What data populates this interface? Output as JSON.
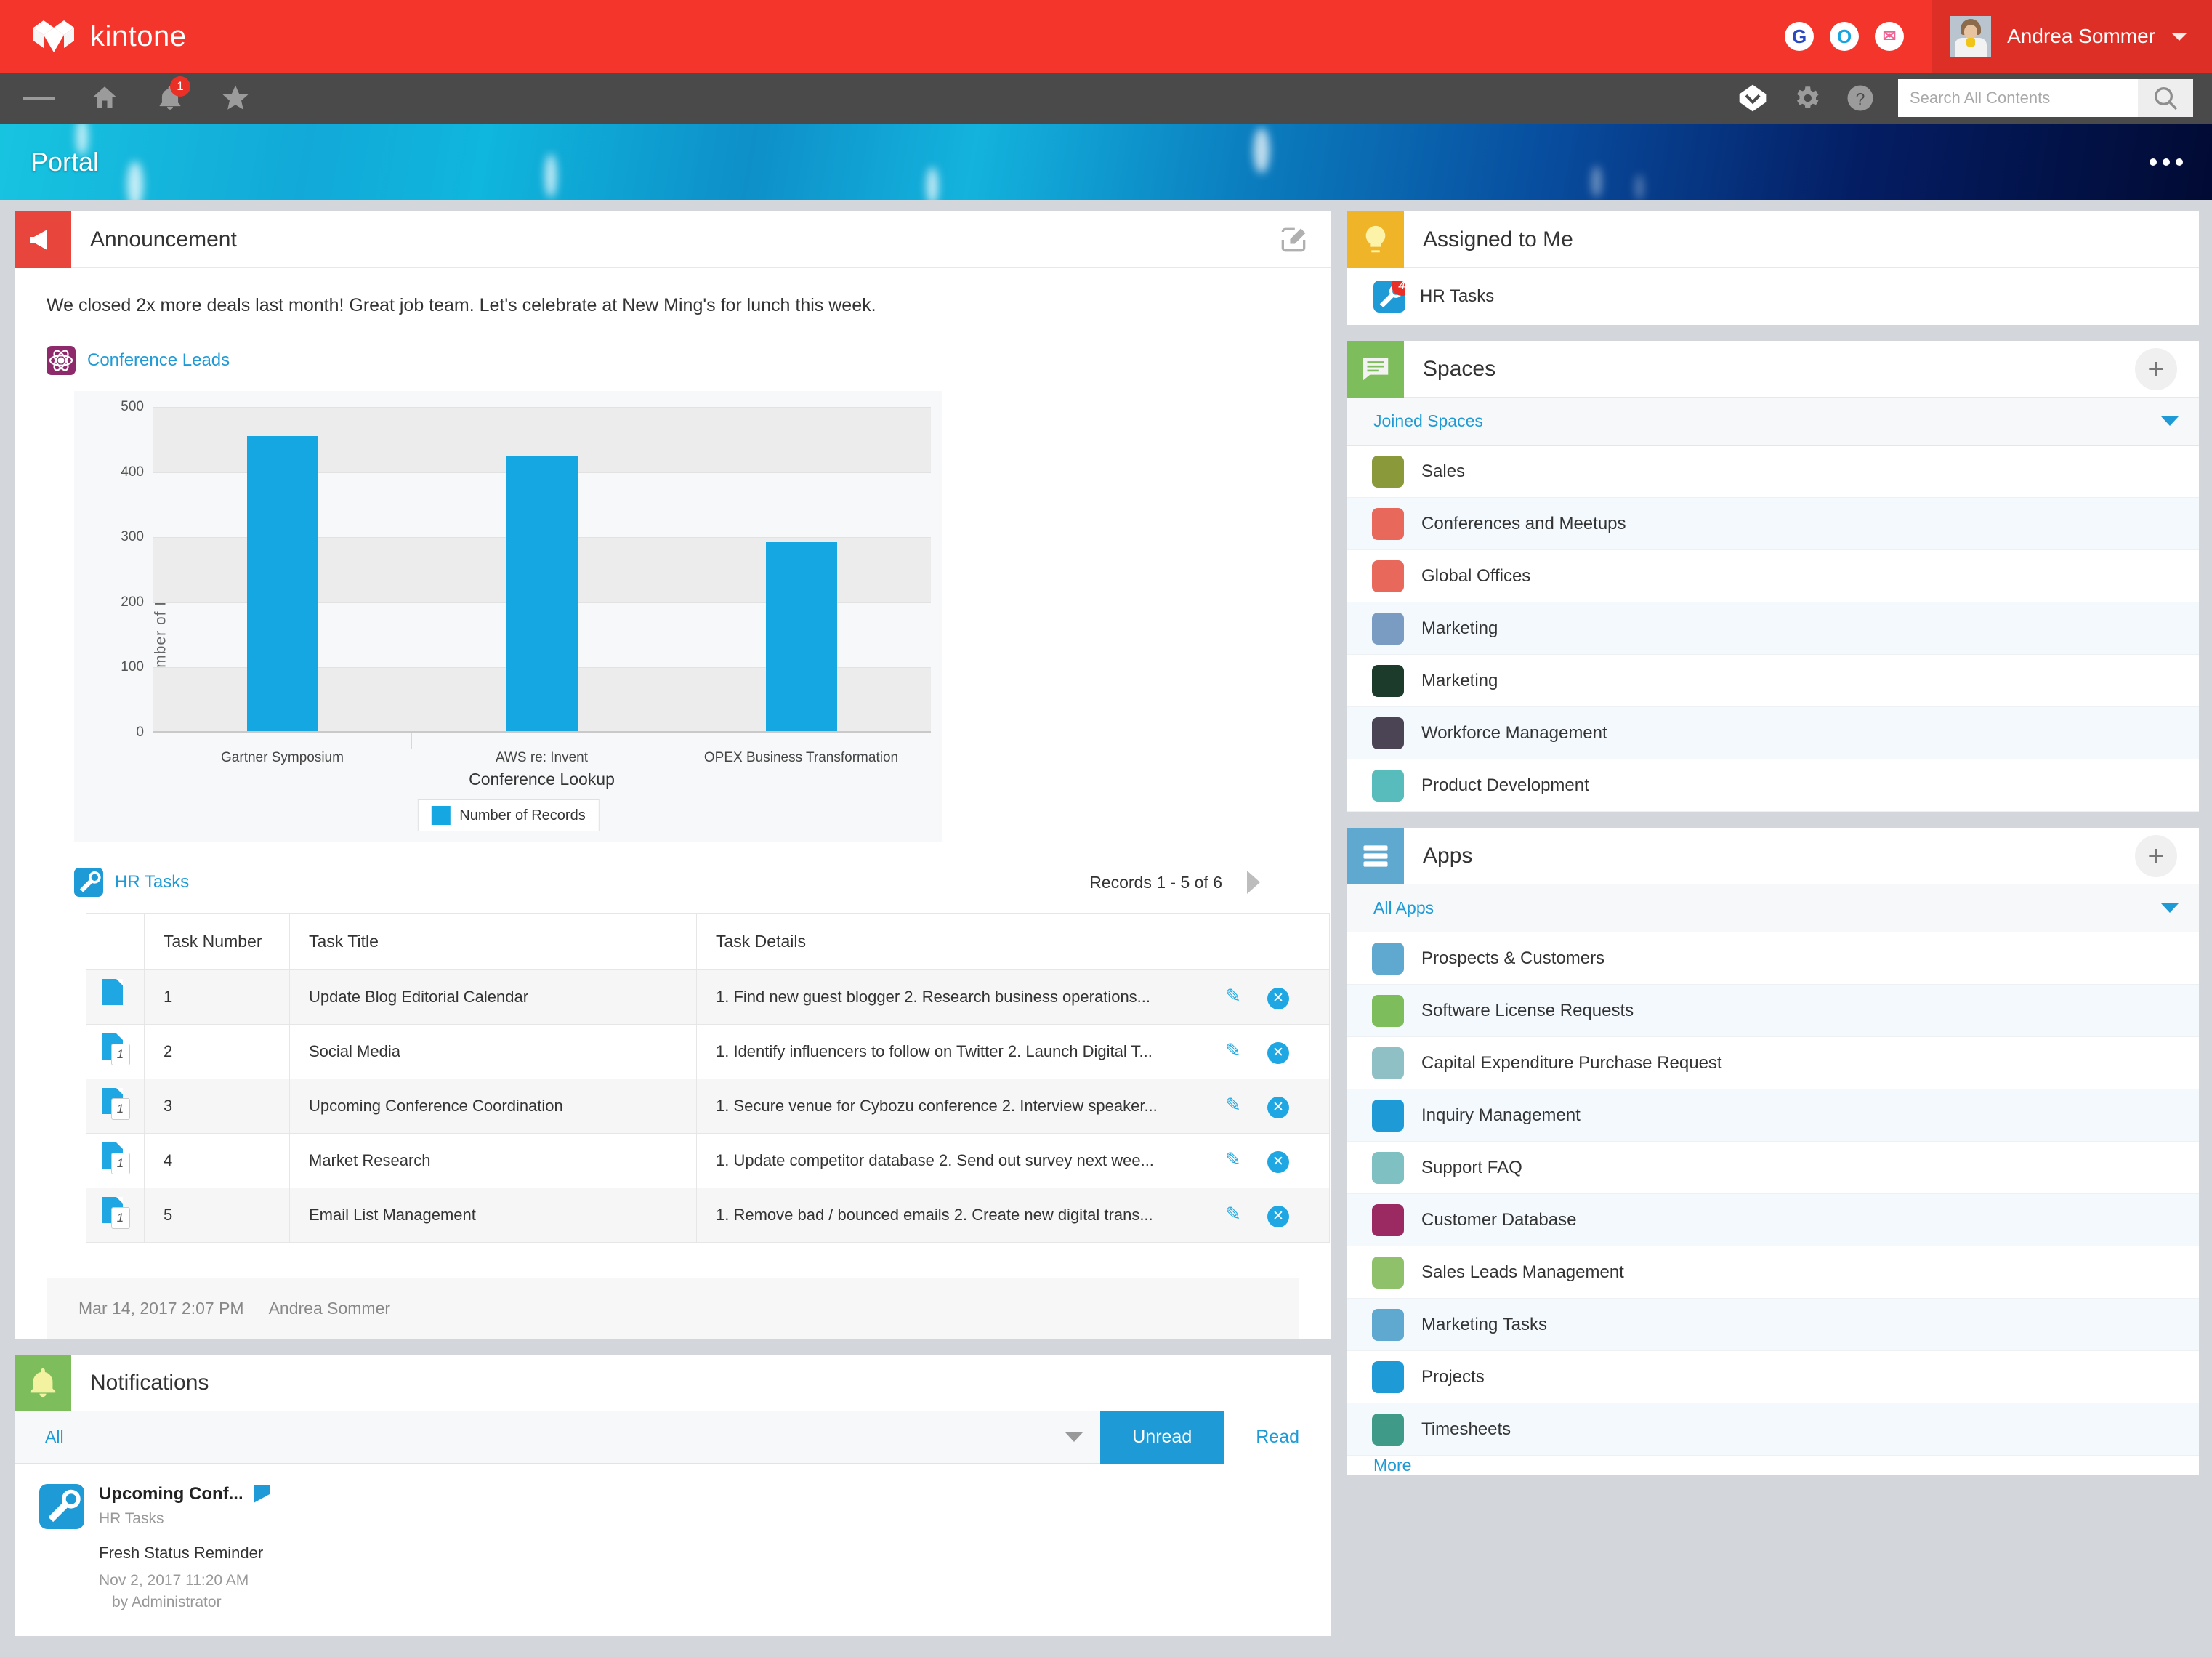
{
  "topbar": {
    "brand": "kintone",
    "icons": [
      {
        "name": "google-icon",
        "glyph": "G"
      },
      {
        "name": "office-icon",
        "glyph": "O"
      },
      {
        "name": "mail-icon",
        "glyph": "✉"
      }
    ],
    "user_name": "Andrea Sommer"
  },
  "navbar": {
    "notification_badge": "1",
    "search_placeholder": "Search All Contents",
    "search_value": ""
  },
  "banner": {
    "title": "Portal"
  },
  "announcement": {
    "title": "Announcement",
    "body": "We closed 2x more deals last month! Great job team. Let's celebrate at New Ming's for lunch this week.",
    "app_link": "Conference Leads",
    "footer_date": "Mar 14, 2017 2:07 PM",
    "footer_author": "Andrea Sommer"
  },
  "chart_data": {
    "type": "bar",
    "title": "",
    "categories": [
      "Gartner Symposium",
      "AWS re: Invent",
      "OPEX Business Transformation"
    ],
    "values": [
      455,
      425,
      292
    ],
    "series": [
      {
        "name": "Number of Records",
        "values": [
          455,
          425,
          292
        ]
      }
    ],
    "xlabel": "Conference Lookup",
    "ylabel": "Number of Records",
    "ylim": [
      0,
      500
    ],
    "yticks": [
      0,
      100,
      200,
      300,
      400,
      500
    ],
    "legend": [
      "Number of Records"
    ],
    "legend_position": "bottom",
    "grid": true,
    "bar_color": "#14a7e2"
  },
  "hr_tasks": {
    "app_name": "HR Tasks",
    "records_info": "Records 1 - 5  of 6",
    "columns": [
      "",
      "Task Number",
      "Task Title",
      "Task Details",
      ""
    ],
    "rows": [
      {
        "icon_count": "",
        "number": "1",
        "title": "Update Blog Editorial Calendar",
        "details": "1. Find new guest blogger  2. Research business operations..."
      },
      {
        "icon_count": "1",
        "number": "2",
        "title": "Social Media",
        "details": "1. Identify influencers to follow on Twitter 2. Launch Digital T..."
      },
      {
        "icon_count": "1",
        "number": "3",
        "title": "Upcoming Conference Coordination",
        "details": "1. Secure venue for Cybozu conference 2. Interview speaker..."
      },
      {
        "icon_count": "1",
        "number": "4",
        "title": "Market Research",
        "details": "1. Update competitor database 2. Send out survey next wee..."
      },
      {
        "icon_count": "1",
        "number": "5",
        "title": "Email List Management",
        "details": "1. Remove bad / bounced emails 2. Create new digital trans..."
      }
    ]
  },
  "notifications": {
    "title": "Notifications",
    "filter_label": "All",
    "tab_unread": "Unread",
    "tab_read": "Read",
    "items": [
      {
        "title": "Upcoming Conf...",
        "app": "HR Tasks",
        "subject": "Fresh Status Reminder",
        "timestamp": "Nov 2, 2017 11:20 AM",
        "author": "by Administrator"
      }
    ]
  },
  "assigned_to_me": {
    "title": "Assigned to Me",
    "items": [
      {
        "label": "HR Tasks",
        "badge": "4"
      }
    ]
  },
  "spaces": {
    "title": "Spaces",
    "group_label": "Joined Spaces",
    "items": [
      {
        "label": "Sales"
      },
      {
        "label": "Conferences and Meetups"
      },
      {
        "label": "Global Offices"
      },
      {
        "label": "Marketing"
      },
      {
        "label": "Marketing"
      },
      {
        "label": "Workforce Management"
      },
      {
        "label": "Product Development"
      }
    ]
  },
  "apps": {
    "title": "Apps",
    "group_label": "All Apps",
    "more_label": "More",
    "items": [
      {
        "label": "Prospects & Customers"
      },
      {
        "label": "Software License Requests"
      },
      {
        "label": "Capital Expenditure Purchase Request"
      },
      {
        "label": "Inquiry Management"
      },
      {
        "label": "Support FAQ"
      },
      {
        "label": "Customer Database"
      },
      {
        "label": "Sales Leads Management"
      },
      {
        "label": "Marketing Tasks"
      },
      {
        "label": "Projects"
      },
      {
        "label": "Timesheets"
      }
    ]
  },
  "colors": {
    "brand_red": "#f4352b",
    "nav_grey": "#4a4a4a",
    "accent_blue": "#1e9bd7",
    "chart_blue": "#14a7e2"
  }
}
